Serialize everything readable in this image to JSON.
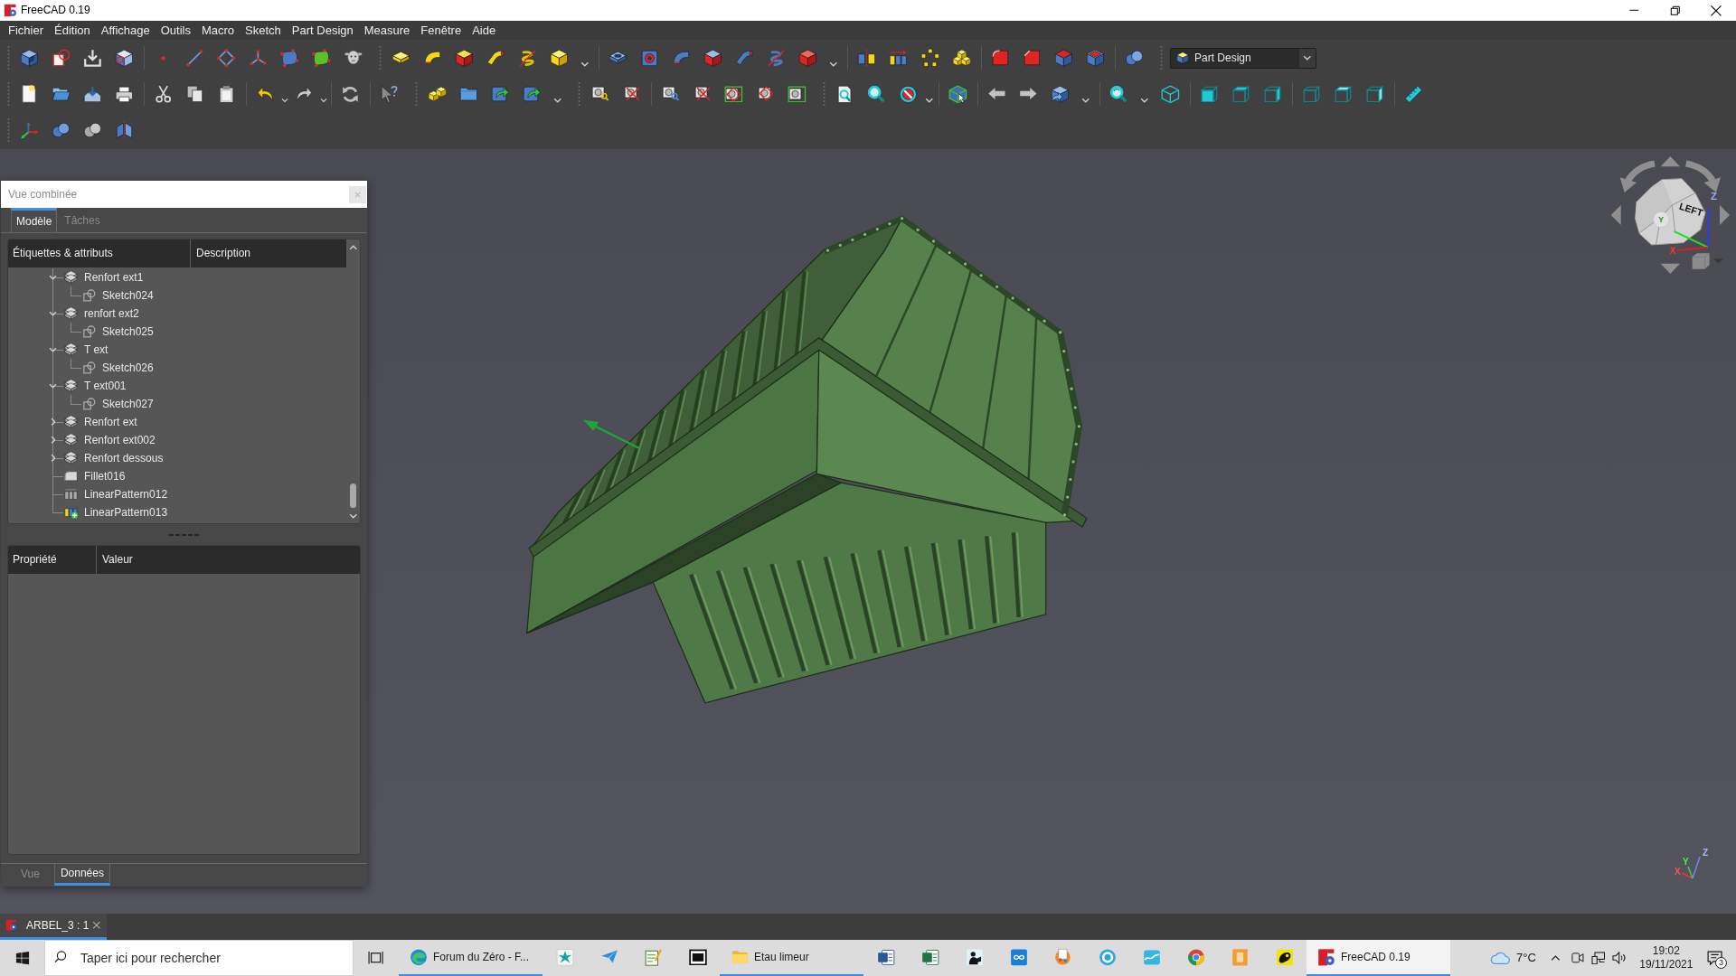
{
  "window": {
    "title": "FreeCAD 0.19"
  },
  "menu": [
    "Fichier",
    "Édition",
    "Affichage",
    "Outils",
    "Macro",
    "Sketch",
    "Part Design",
    "Measure",
    "Fenêtre",
    "Aide"
  ],
  "workbench": {
    "value": "Part Design"
  },
  "combo_view": {
    "title": "Vue combinée",
    "tabs": [
      {
        "label": "Modèle",
        "selected": true
      },
      {
        "label": "Tâches",
        "selected": false
      }
    ],
    "tree": {
      "columns": [
        "Étiquettes & attributs",
        "Description"
      ],
      "items": [
        {
          "label": "Renfort ext1",
          "kind": "pad",
          "visible": false,
          "tip": false,
          "expanded": true,
          "children": [
            {
              "label": "Sketch024",
              "kind": "sketch",
              "visible": false
            }
          ]
        },
        {
          "label": "renfort ext2",
          "kind": "pad",
          "visible": false,
          "tip": false,
          "expanded": true,
          "children": [
            {
              "label": "Sketch025",
              "kind": "sketch",
              "visible": false
            }
          ]
        },
        {
          "label": "T ext",
          "kind": "pad",
          "visible": false,
          "tip": false,
          "expanded": true,
          "children": [
            {
              "label": "Sketch026",
              "kind": "sketch",
              "visible": false
            }
          ]
        },
        {
          "label": "T ext001",
          "kind": "pad",
          "visible": false,
          "tip": false,
          "expanded": true,
          "children": [
            {
              "label": "Sketch027",
              "kind": "sketch",
              "visible": false
            }
          ]
        },
        {
          "label": "Renfort ext",
          "kind": "pad",
          "visible": false,
          "tip": false,
          "expanded": false
        },
        {
          "label": "Renfort ext002",
          "kind": "pad",
          "visible": false,
          "tip": false,
          "expanded": false
        },
        {
          "label": "Renfort dessous",
          "kind": "pad",
          "visible": false,
          "tip": false,
          "expanded": false
        },
        {
          "label": "Fillet016",
          "kind": "fillet",
          "visible": false,
          "tip": false
        },
        {
          "label": "LinearPattern012",
          "kind": "pattern",
          "visible": false,
          "tip": false
        },
        {
          "label": "LinearPattern013",
          "kind": "pattern",
          "visible": true,
          "tip": true
        }
      ]
    },
    "properties": {
      "columns": [
        "Propriété",
        "Valeur"
      ]
    },
    "bottom_tabs": [
      {
        "label": "Vue",
        "selected": false
      },
      {
        "label": "Données",
        "selected": true
      }
    ]
  },
  "view": {
    "navigation_cube": {
      "face_label": "LEFT",
      "axis_labels": [
        "X",
        "Y",
        "Z"
      ]
    },
    "axis_triad": {
      "labels": [
        "X",
        "Y",
        "Z"
      ]
    }
  },
  "document_tabs": [
    {
      "label": "ARBEL_3 : 1",
      "selected": true
    }
  ],
  "taskbar": {
    "search": {
      "placeholder": "Taper ici pour rechercher"
    },
    "apps": [
      {
        "kind": "browser",
        "label": "Forum du Zéro - F...",
        "running": true,
        "selected": false
      },
      {
        "kind": "star",
        "running": false,
        "selected": false
      },
      {
        "kind": "plane",
        "running": false,
        "selected": false
      },
      {
        "kind": "notepad",
        "running": false,
        "selected": false
      },
      {
        "kind": "archive",
        "running": false,
        "selected": false
      },
      {
        "kind": "folder",
        "label": "Etau limeur",
        "running": true,
        "selected": false
      },
      {
        "kind": "doc",
        "running": false,
        "selected": false
      },
      {
        "kind": "sheet",
        "running": false,
        "selected": false
      },
      {
        "kind": "reader",
        "running": false,
        "selected": false
      },
      {
        "kind": "infinity",
        "running": false,
        "selected": false
      },
      {
        "kind": "paint",
        "running": false,
        "selected": false
      },
      {
        "kind": "ring",
        "running": false,
        "selected": false
      },
      {
        "kind": "wave",
        "running": false,
        "selected": false
      },
      {
        "kind": "segments",
        "running": false,
        "selected": false
      },
      {
        "kind": "tile",
        "running": false,
        "selected": false
      },
      {
        "kind": "blob",
        "running": false,
        "selected": false
      },
      {
        "kind": "freecad",
        "label": "FreeCAD 0.19",
        "running": true,
        "selected": true
      }
    ],
    "tray": {
      "temperature": "7°C",
      "time": "19:02",
      "date": "19/11/2021",
      "notification_count": "3"
    }
  }
}
